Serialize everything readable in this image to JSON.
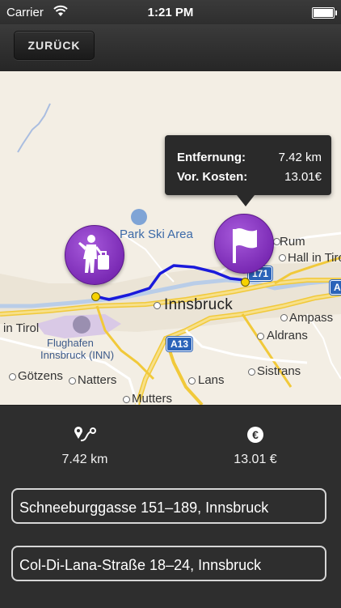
{
  "status_bar": {
    "carrier": "Carrier",
    "time": "1:21 PM",
    "icons": [
      "wifi-icon",
      "battery-icon"
    ]
  },
  "nav": {
    "back_label": "ZURÜCK"
  },
  "map": {
    "labels": {
      "ski_area": "Park Ski Area",
      "rum": "Rum",
      "hall": "Hall in Tirol",
      "innsbruck": "Innsbruck",
      "ampass": "Ampass",
      "in_tirol": "in Tirol",
      "airport_line1": "Flughafen",
      "airport_line2": "Innsbruck (INN)",
      "aldrans": "Aldrans",
      "sistrans": "Sistrans",
      "goetzens": "Götzens",
      "natters": "Natters",
      "lans": "Lans",
      "mutters": "Mutters"
    },
    "road_shields": {
      "a13": "A13",
      "a171": "171",
      "a_edge": "A"
    },
    "colors": {
      "route": "#1a1adb",
      "pin": "#7b2bb5",
      "roads": "#f4cf3e",
      "water": "#b9cde8"
    },
    "icons": [
      "hitchhiker-icon",
      "flag-icon",
      "airport-icon",
      "skier-icon"
    ]
  },
  "callout": {
    "distance_label": "Entfernung:",
    "distance_value": "7.42 km",
    "cost_label": "Vor. Kosten:",
    "cost_value": "13.01€"
  },
  "summary": {
    "distance": "7.42 km",
    "cost": "13.01 €",
    "icons": [
      "route-icon",
      "euro-icon"
    ]
  },
  "addresses": {
    "from": "Schneeburggasse 151–189, Innsbruck",
    "to": "Col-Di-Lana-Straße 18–24, Innsbruck"
  }
}
